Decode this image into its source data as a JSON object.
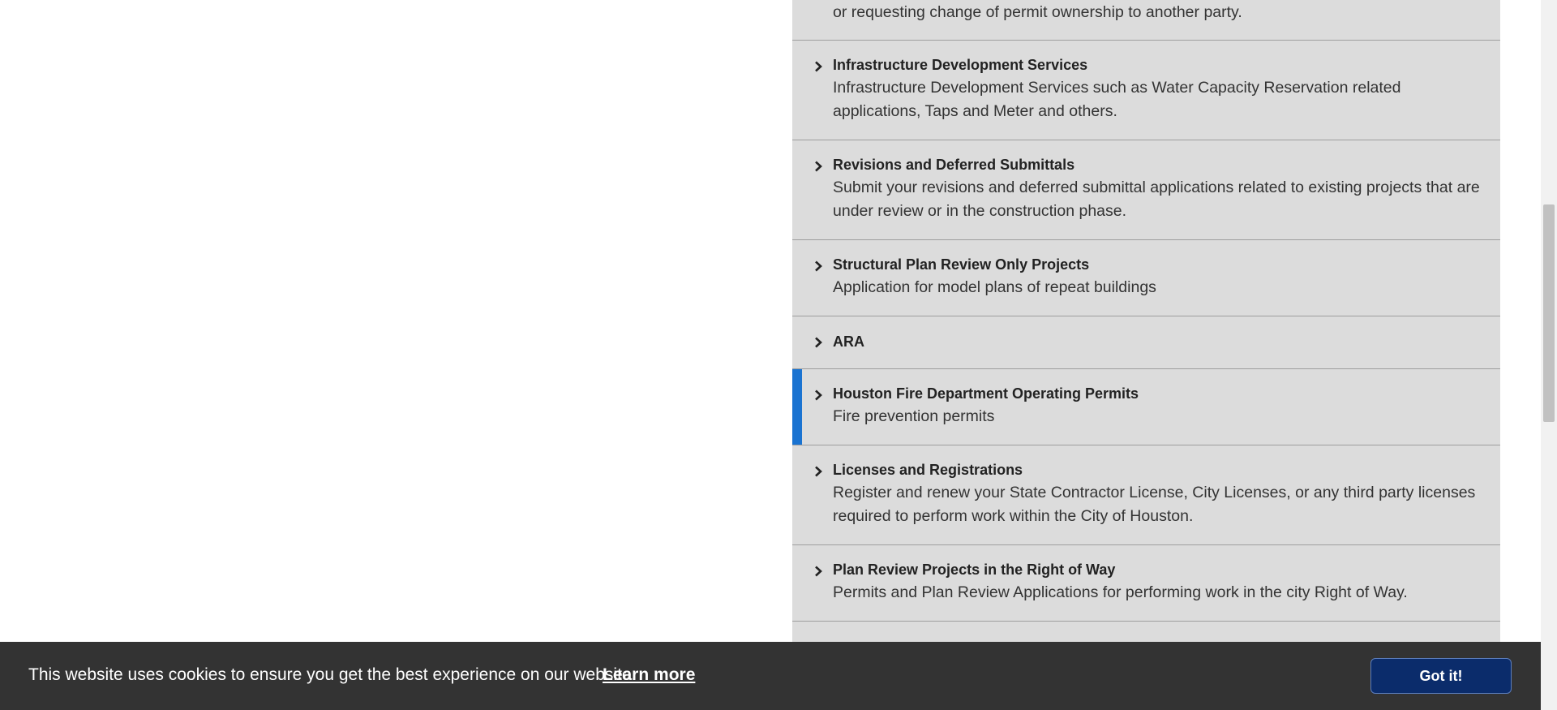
{
  "top_fragment": "or requesting change of permit ownership to another party.",
  "items": [
    {
      "title": "Infrastructure Development Services",
      "desc1": "Infrastructure Development Services such as Water Capacity Reservation related",
      "desc2": "applications, Taps and Meter and others."
    },
    {
      "title": "Revisions and Deferred Submittals",
      "desc1": "Submit your revisions and deferred submittal applications related to existing projects that are",
      "desc2": "under review or in the construction phase."
    },
    {
      "title": "Structural Plan Review Only Projects",
      "desc1": "Application for model plans of repeat buildings"
    },
    {
      "title": "ARA"
    },
    {
      "title": "Houston Fire Department Operating Permits",
      "desc1": "Fire prevention permits"
    },
    {
      "title": "Licenses and Registrations",
      "desc1": "Register and renew your State Contractor License, City Licenses, or any third party licenses",
      "desc2": "required to perform work within the City of Houston."
    },
    {
      "title": "Plan Review Projects in the Right of Way",
      "desc1": "Permits and Plan Review Applications for performing work in the city Right of Way."
    }
  ],
  "cookie": {
    "message": "This website uses cookies to ensure you get the best experience on our website.",
    "learn_more": "Learn more",
    "accept": "Got it!"
  },
  "colors": {
    "panel": "#dcdcdc",
    "active_accent": "#1a73d1",
    "cookie_bar": "#333333",
    "cookie_button": "#0b2c6b"
  },
  "icons": {
    "item_expand": "chevron-right-icon"
  }
}
